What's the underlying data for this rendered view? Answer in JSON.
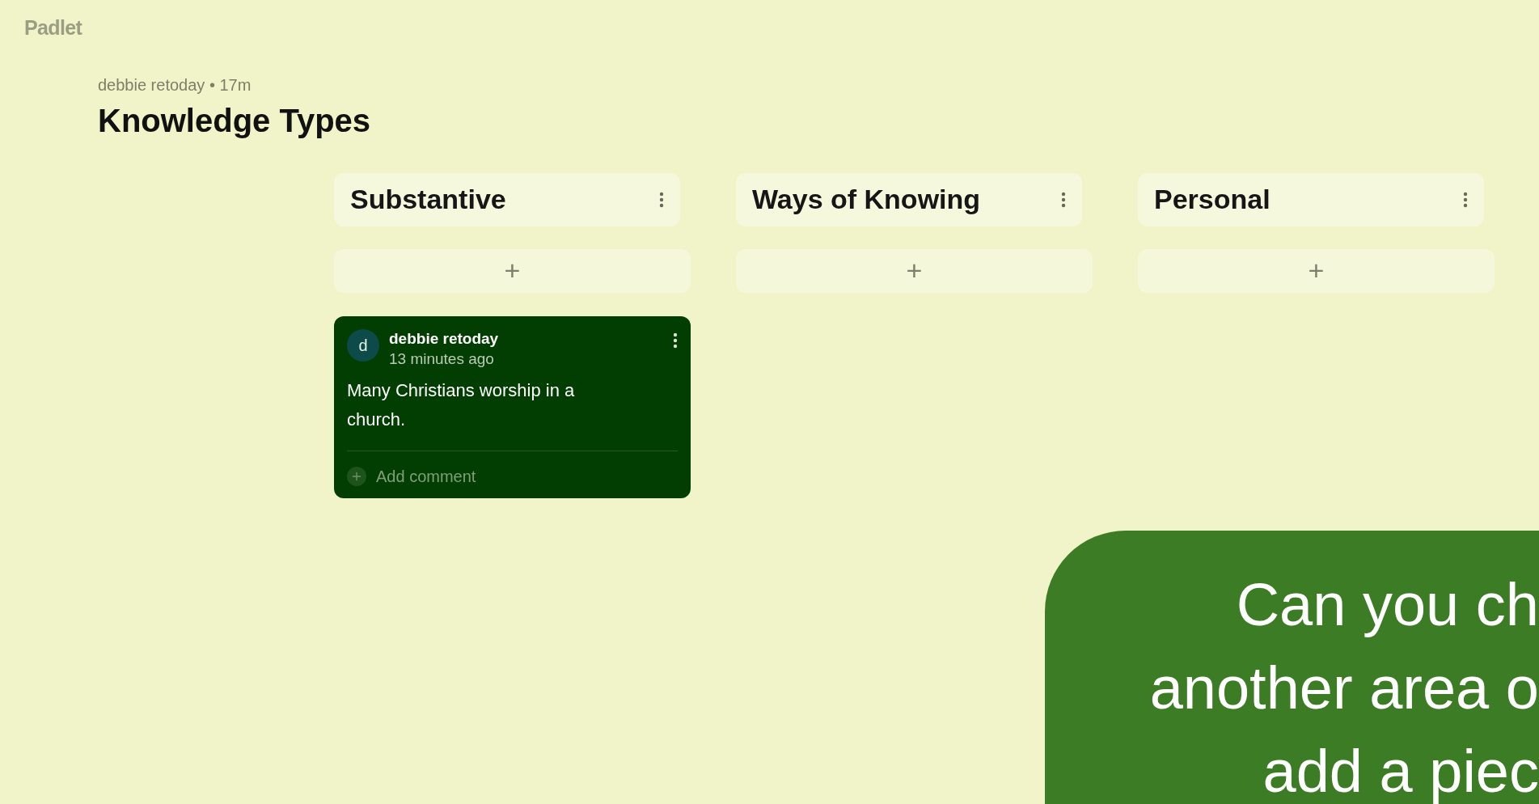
{
  "logo": "Padlet",
  "board": {
    "author": "debbie retoday",
    "separator": "•",
    "age": "17m",
    "title": "Knowledge Types"
  },
  "columns": [
    {
      "title": "Substantive",
      "add_label": "+",
      "posts": [
        {
          "avatar": "d",
          "author": "debbie retoday",
          "time": "13 minutes ago",
          "body": "Many Christians worship in a church.",
          "comment_label": "Add comment"
        }
      ]
    },
    {
      "title": "Ways of Knowing",
      "add_label": "+"
    },
    {
      "title": "Personal",
      "add_label": "+"
    }
  ],
  "overlay": {
    "lines": [
      "Can you ch",
      "another area o",
      "add a piec"
    ]
  }
}
